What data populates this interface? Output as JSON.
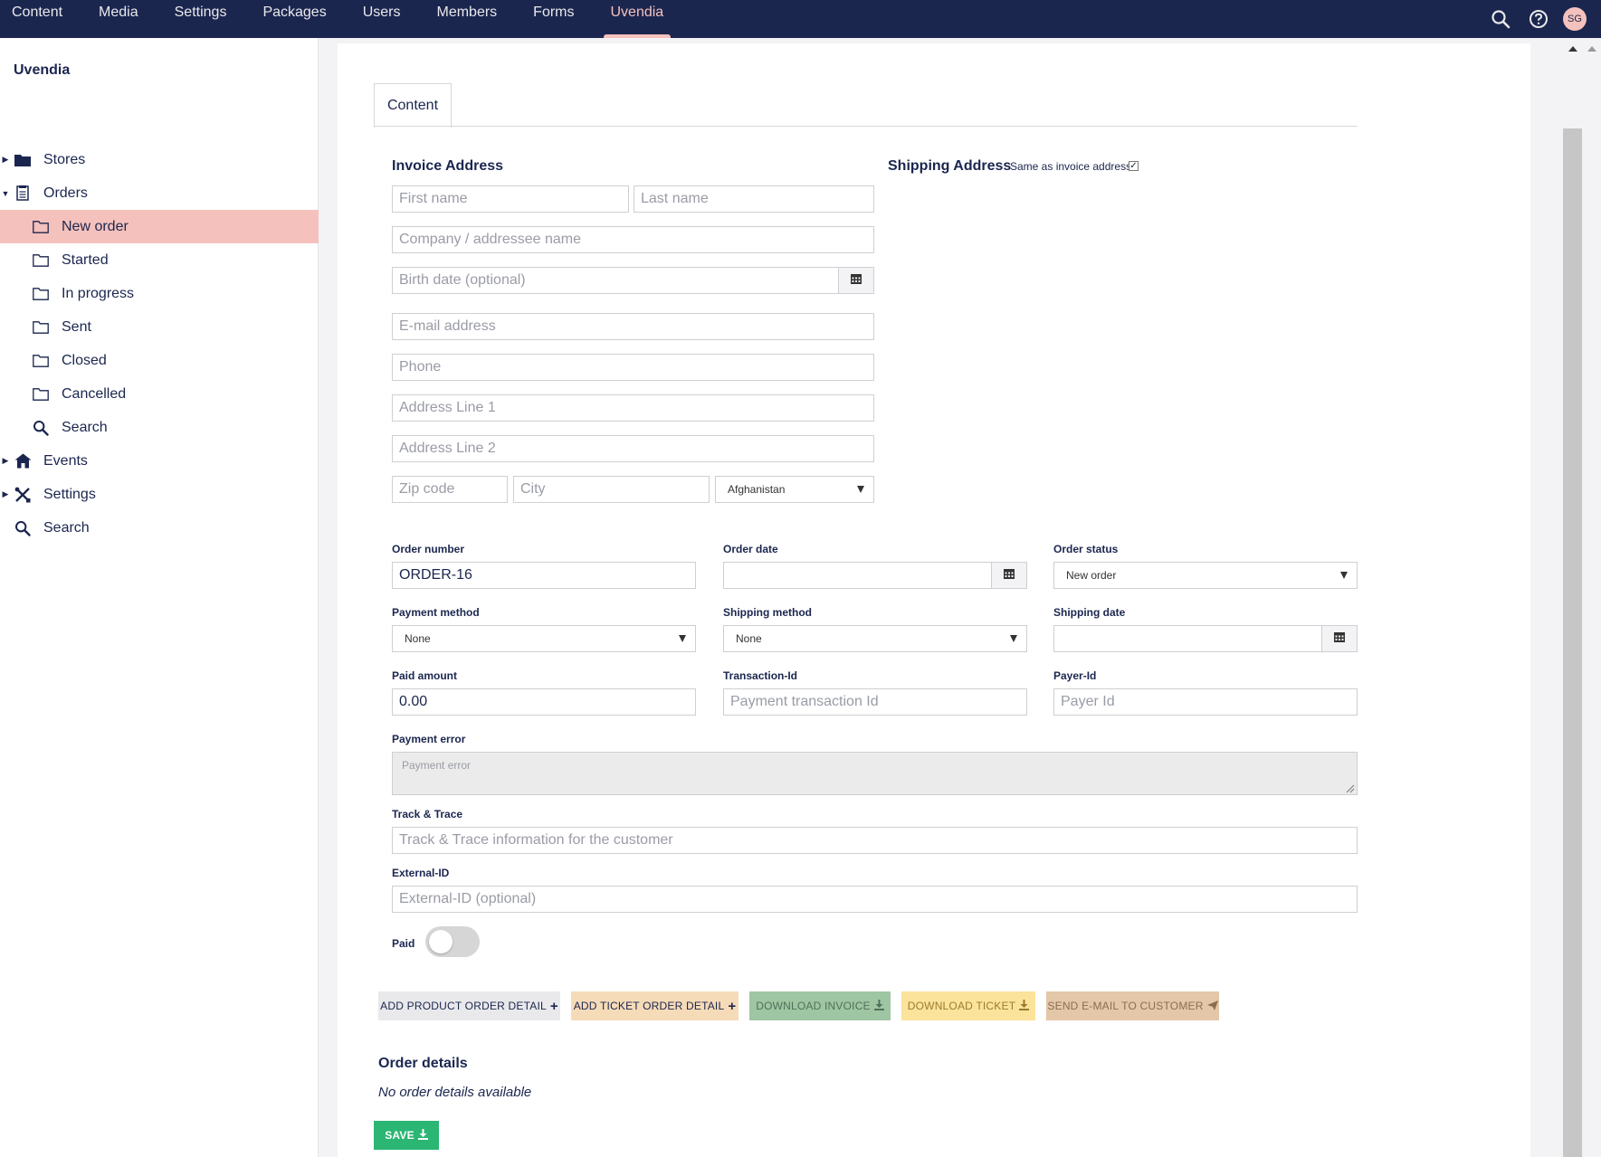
{
  "nav": {
    "items": [
      "Content",
      "Media",
      "Settings",
      "Packages",
      "Users",
      "Members",
      "Forms",
      "Uvendia"
    ],
    "active": "Uvendia",
    "user_initials": "SG"
  },
  "sidebar": {
    "title": "Uvendia",
    "items": [
      {
        "label": "Stores",
        "icon": "folder-icon"
      },
      {
        "label": "Orders",
        "icon": "orders-icon"
      },
      {
        "label": "New order",
        "icon": "folder-outline-icon"
      },
      {
        "label": "Started",
        "icon": "folder-outline-icon"
      },
      {
        "label": "In progress",
        "icon": "folder-outline-icon"
      },
      {
        "label": "Sent",
        "icon": "folder-outline-icon"
      },
      {
        "label": "Closed",
        "icon": "folder-outline-icon"
      },
      {
        "label": "Cancelled",
        "icon": "folder-outline-icon"
      },
      {
        "label": "Search",
        "icon": "search-icon"
      },
      {
        "label": "Events",
        "icon": "events-icon"
      },
      {
        "label": "Settings",
        "icon": "settings-icon"
      },
      {
        "label": "Search",
        "icon": "search-icon"
      }
    ],
    "selected": "New order"
  },
  "tabs": [
    "Content"
  ],
  "invoice": {
    "heading": "Invoice Address",
    "first_name_ph": "First name",
    "last_name_ph": "Last name",
    "company_ph": "Company / addressee name",
    "birth_ph": "Birth date (optional)",
    "email_ph": "E-mail address",
    "phone_ph": "Phone",
    "addr1_ph": "Address Line 1",
    "addr2_ph": "Address Line 2",
    "zip_ph": "Zip code",
    "city_ph": "City",
    "country": "Afghanistan"
  },
  "shipping": {
    "heading": "Shipping Address",
    "same_label": "Same as invoice address"
  },
  "order": {
    "number_label": "Order number",
    "number_value": "ORDER-16",
    "date_label": "Order date",
    "status_label": "Order status",
    "status_value": "New order",
    "payment_method_label": "Payment method",
    "payment_method_value": "None",
    "shipping_method_label": "Shipping method",
    "shipping_method_value": "None",
    "shipping_date_label": "Shipping date",
    "paid_amount_label": "Paid amount",
    "paid_amount_value": "0.00",
    "transaction_label": "Transaction-Id",
    "transaction_ph": "Payment transaction Id",
    "payer_label": "Payer-Id",
    "payer_ph": "Payer Id",
    "payment_error_label": "Payment error",
    "payment_error_ph": "Payment error",
    "track_label": "Track & Trace",
    "track_ph": "Track & Trace information for the customer",
    "external_label": "External-ID",
    "external_ph": "External-ID (optional)",
    "paid_label": "Paid"
  },
  "buttons": {
    "add_product": "ADD PRODUCT ORDER DETAIL",
    "add_ticket": "ADD TICKET ORDER DETAIL",
    "download_invoice": "DOWNLOAD INVOICE",
    "download_ticket": "DOWNLOAD TICKET",
    "send_email": "SEND E-MAIL TO CUSTOMER",
    "save": "SAVE"
  },
  "details": {
    "title": "Order details",
    "empty": "No order details available"
  },
  "colors": {
    "nav_bg": "#1b264f",
    "accent": "#f5c1bc",
    "save": "#2bb673"
  }
}
